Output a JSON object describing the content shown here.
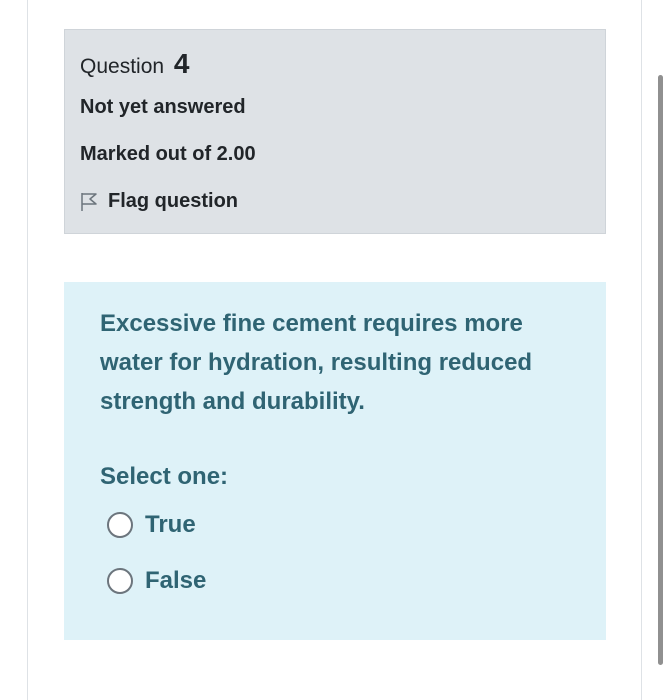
{
  "question_info": {
    "label": "Question",
    "number": "4",
    "state": "Not yet answered",
    "grade": "Marked out of 2.00",
    "flag_label": "Flag question"
  },
  "formulation": {
    "question_text": "Excessive fine cement requires more water for hydration, resulting reduced strength and durability.",
    "prompt": "Select one:",
    "options": [
      {
        "label": "True",
        "selected": false
      },
      {
        "label": "False",
        "selected": false
      }
    ]
  },
  "icons": {
    "flag": "flag-outline-icon",
    "radio": "radio-unchecked-icon"
  },
  "colors": {
    "info_background": "#dee2e6",
    "formulation_background": "#def2f8",
    "formulation_text": "#2f6473",
    "info_text": "#212529"
  }
}
